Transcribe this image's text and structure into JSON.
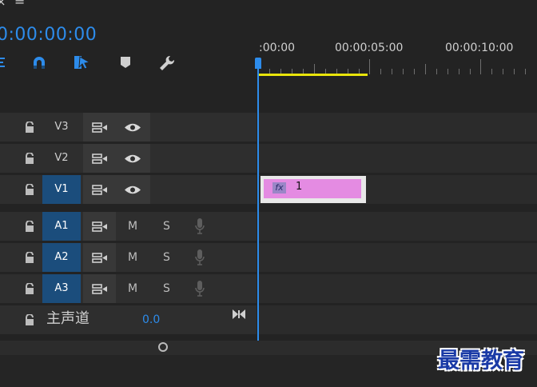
{
  "menu": {
    "close_glyph": "×",
    "menu_glyph": "≡"
  },
  "timecode": "0:00:00:00",
  "toolbar": {
    "icons": [
      "nest-icon",
      "snap-magnet-icon",
      "linked-selection-icon",
      "add-marker-icon",
      "settings-wrench-icon"
    ]
  },
  "ruler": {
    "labels": [
      ":00:00",
      "00:00:05:00",
      "00:00:10:00"
    ],
    "work_area_color": "#e9e40b"
  },
  "video_tracks": [
    {
      "name": "V3",
      "active": false
    },
    {
      "name": "V2",
      "active": false
    },
    {
      "name": "V1",
      "active": true
    }
  ],
  "audio_tracks": [
    {
      "name": "A1",
      "mute": "M",
      "solo": "S"
    },
    {
      "name": "A2",
      "mute": "M",
      "solo": "S"
    },
    {
      "name": "A3",
      "mute": "M",
      "solo": "S"
    }
  ],
  "master": {
    "label": "主声道",
    "value": "0.0"
  },
  "clip": {
    "fx_label": "fx",
    "name": "1",
    "color": "#e48be2"
  },
  "watermark": "最需教育",
  "colors": {
    "accent": "#2d8ceb",
    "active_track": "#1b4d7c"
  }
}
